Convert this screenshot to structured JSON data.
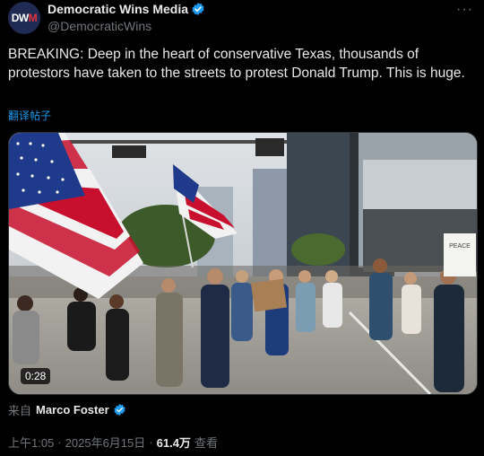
{
  "author": {
    "avatar_text_prefix": "DW",
    "avatar_text_suffix": "M",
    "display_name": "Democratic Wins Media",
    "handle": "@DemocraticWins"
  },
  "more_label": "···",
  "tweet": {
    "text": "BREAKING: Deep in the heart of conservative Texas, thousands of protestors have taken to the streets to protest Donald Trump. This is huge.",
    "translate_label": "翻译帖子"
  },
  "media": {
    "duration": "0:28",
    "sign_text": "PEACE"
  },
  "source": {
    "prefix": "来自",
    "name": "Marco Foster"
  },
  "meta": {
    "time": "上午1:05",
    "date": "2025年6月15日",
    "separator": "·",
    "views": "61.4万",
    "views_label": "查看"
  },
  "colors": {
    "verified": "#1d9bf0",
    "link": "#1d9bf0",
    "muted": "#71767b",
    "flag_red": "#c8102e",
    "flag_blue": "#1f3a8a"
  }
}
